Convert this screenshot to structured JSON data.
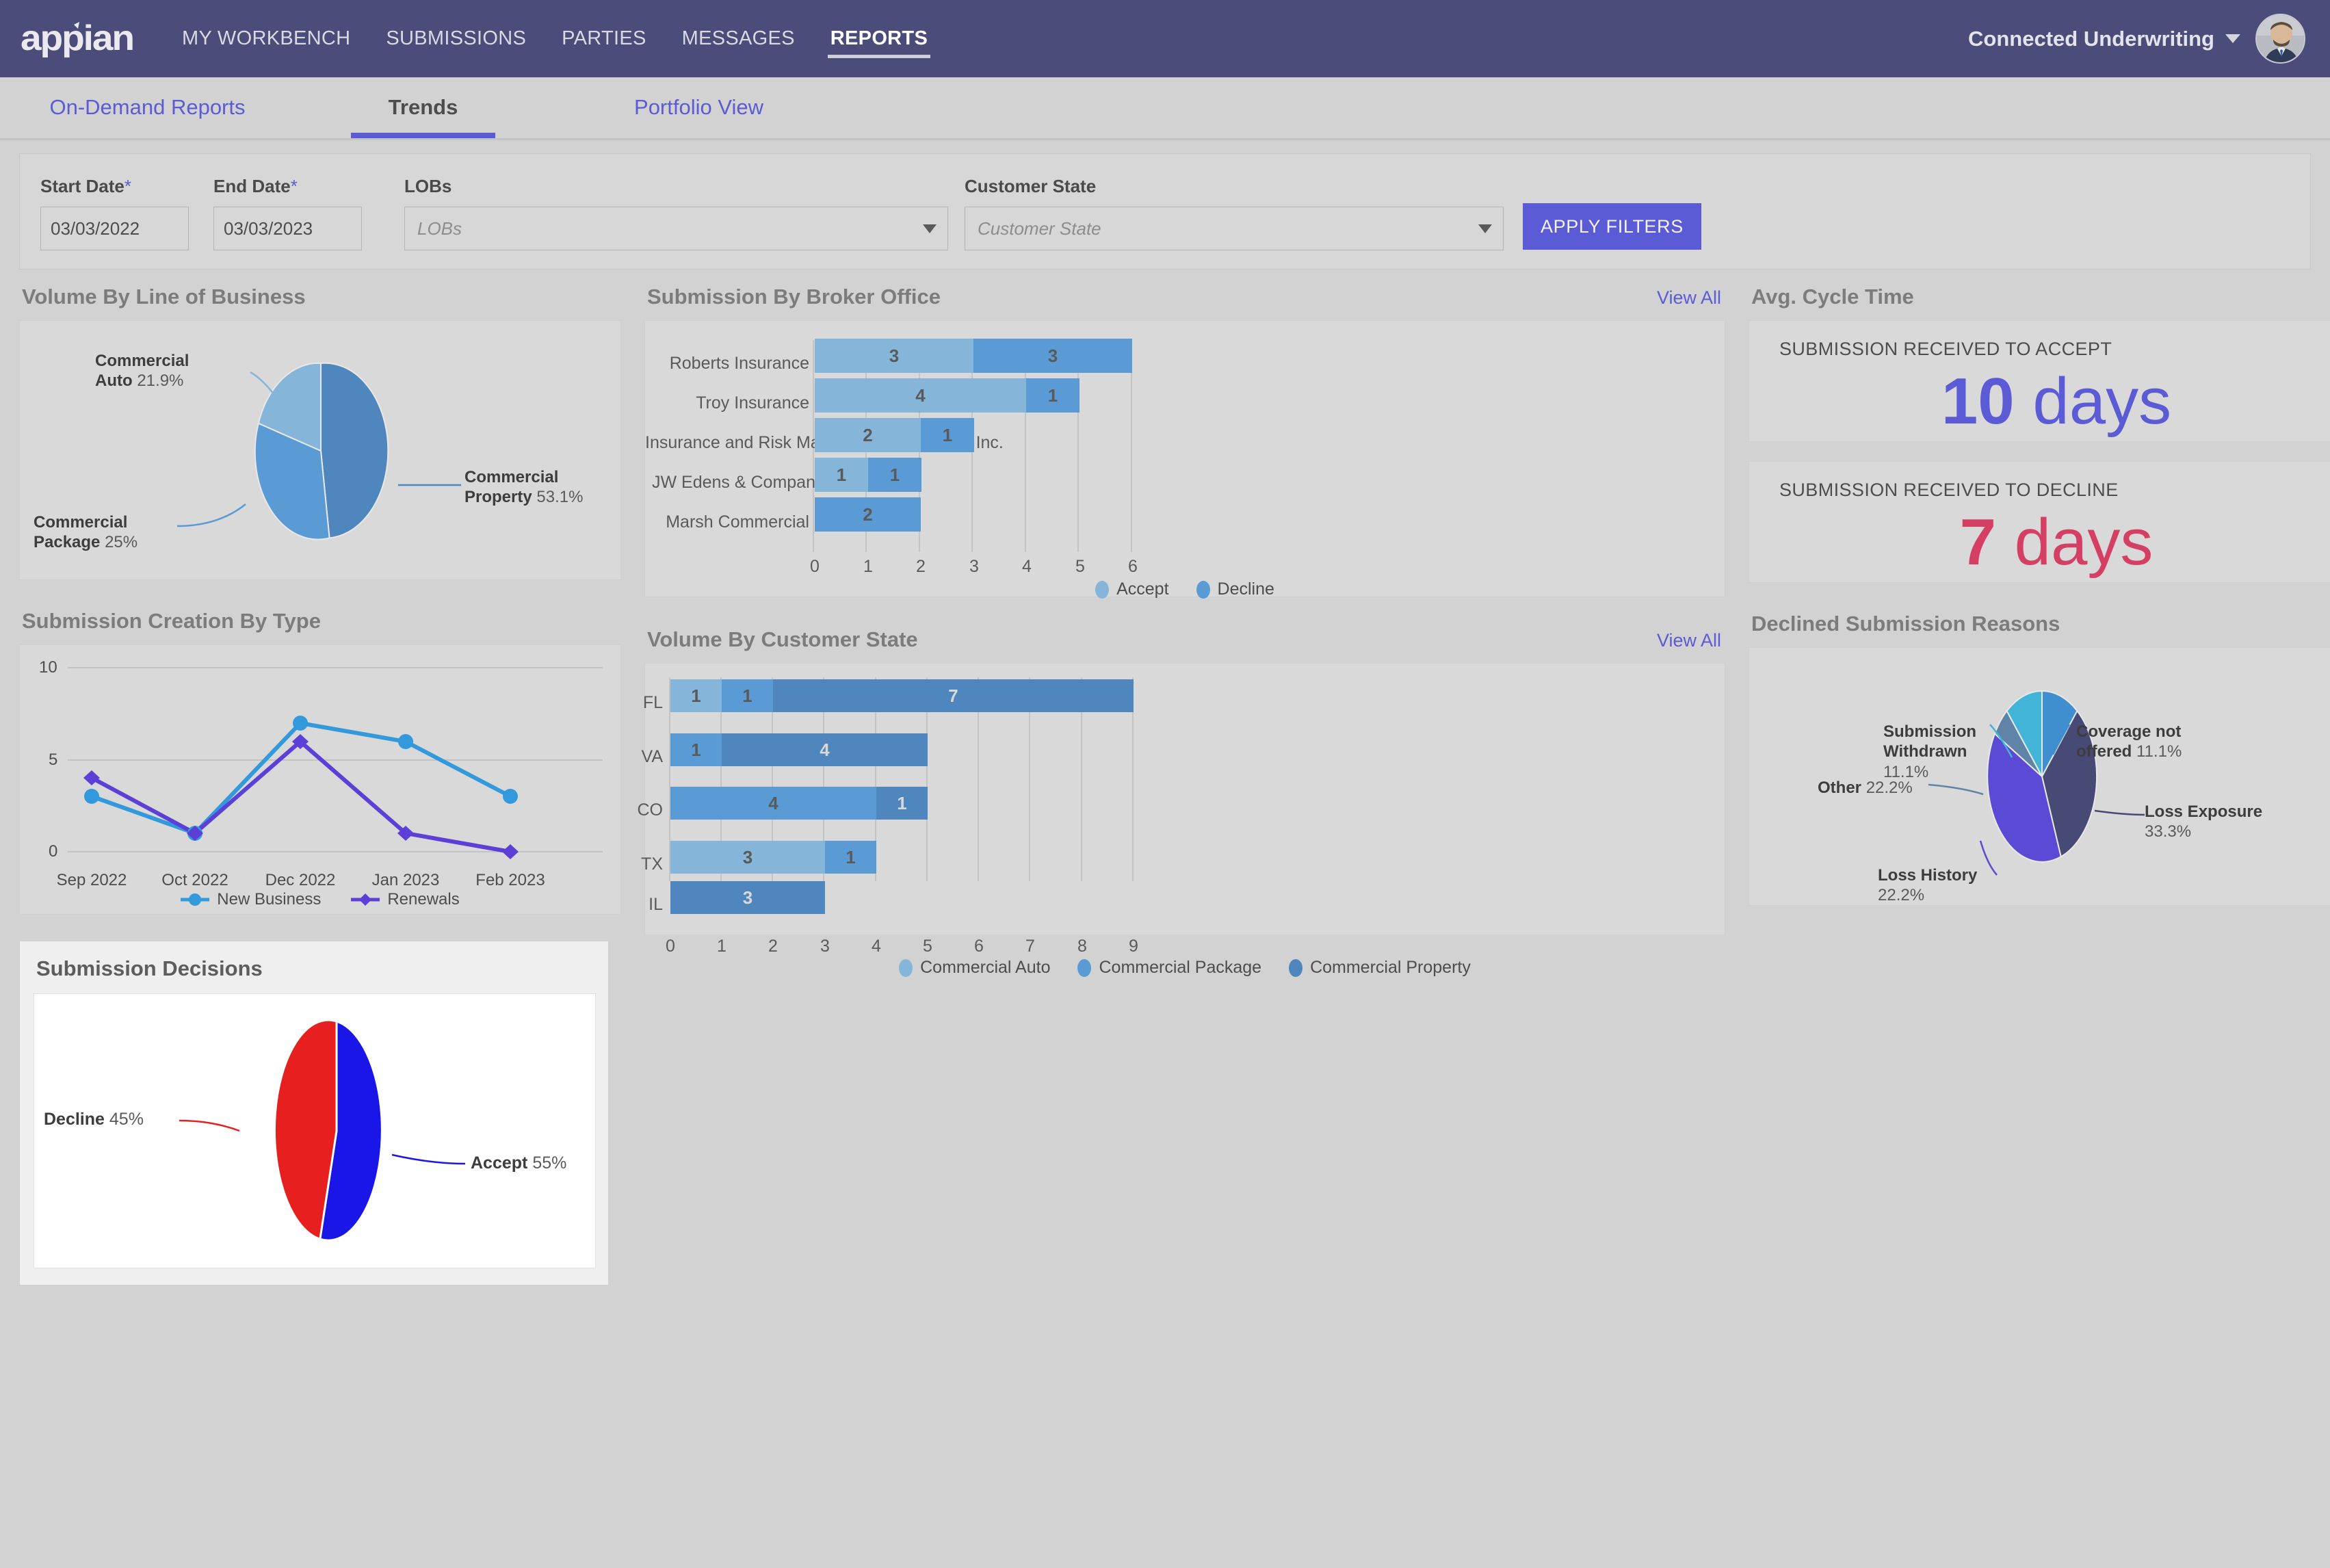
{
  "topnav": {
    "logo_text": "appian",
    "links": [
      {
        "label": "MY WORKBENCH",
        "active": false
      },
      {
        "label": "SUBMISSIONS",
        "active": false
      },
      {
        "label": "PARTIES",
        "active": false
      },
      {
        "label": "MESSAGES",
        "active": false
      },
      {
        "label": "REPORTS",
        "active": true
      }
    ],
    "org": "Connected Underwriting"
  },
  "tabs": [
    {
      "label": "On-Demand Reports",
      "active": false
    },
    {
      "label": "Trends",
      "active": true
    },
    {
      "label": "Portfolio View",
      "active": false
    }
  ],
  "filters": {
    "start_date": {
      "label": "Start Date",
      "required": "*",
      "value": "03/03/2022"
    },
    "end_date": {
      "label": "End Date",
      "required": "*",
      "value": "03/03/2023"
    },
    "lobs": {
      "label": "LOBs",
      "placeholder": "LOBs",
      "value": ""
    },
    "customer_state": {
      "label": "Customer State",
      "placeholder": "Customer State",
      "value": ""
    },
    "apply_label": "APPLY FILTERS"
  },
  "sections": {
    "volume_lob": "Volume By Line of Business",
    "submission_creation": "Submission Creation By Type",
    "submission_decisions": "Submission Decisions",
    "broker_office": "Submission By Broker Office",
    "customer_state": "Volume By Customer State",
    "cycle_time": "Avg. Cycle Time",
    "declined_reasons": "Declined Submission Reasons",
    "view_all": "View All"
  },
  "cycle_time": {
    "accept": {
      "label": "SUBMISSION RECEIVED TO ACCEPT",
      "number": "10",
      "unit": "days",
      "color": "#5b5bd6"
    },
    "decline": {
      "label": "SUBMISSION RECEIVED TO DECLINE",
      "number": "7",
      "unit": "days",
      "color": "#d43f63"
    }
  },
  "colors": {
    "accent": "#5b5bd6",
    "navbar": "#4b4c79",
    "bar_light": "#86b5da",
    "bar_medium": "#5b9bd5",
    "bar_dark": "#4e86bd",
    "decline_red": "#e81f1f",
    "accept_blue": "#1a16e8"
  },
  "chart_data": [
    {
      "type": "pie",
      "id": "volume-by-lob",
      "title": "Volume By Line of Business",
      "labels": [
        "Commercial Property",
        "Commercial Package",
        "Commercial Auto"
      ],
      "values": [
        53.1,
        25,
        21.9
      ],
      "value_labels": [
        "53.1%",
        "25%",
        "21.9%"
      ],
      "colors": [
        "#4e86bd",
        "#5b9bd5",
        "#86b5da"
      ],
      "legend": "callout-labels"
    },
    {
      "type": "line",
      "id": "submission-creation-by-type",
      "title": "Submission Creation By Type",
      "categories": [
        "Sep 2022",
        "Oct 2022",
        "Dec 2022",
        "Jan 2023",
        "Feb 2023"
      ],
      "series": [
        {
          "name": "New Business",
          "values": [
            3,
            1,
            7,
            6,
            3
          ],
          "color": "#3399dd"
        },
        {
          "name": "Renewals",
          "values": [
            4,
            1,
            6,
            1,
            0
          ],
          "color": "#5b3fd6"
        }
      ],
      "ylim": [
        0,
        10
      ],
      "yticks": [
        0,
        5,
        10
      ],
      "xlabel": "",
      "ylabel": "",
      "grid": true,
      "legend": "bottom"
    },
    {
      "type": "pie",
      "id": "submission-decisions",
      "title": "Submission Decisions",
      "labels": [
        "Accept",
        "Decline"
      ],
      "values": [
        55,
        45
      ],
      "value_labels": [
        "55%",
        "45%"
      ],
      "colors": [
        "#1a16e8",
        "#e81f1f"
      ],
      "legend": "callout-labels"
    },
    {
      "type": "bar",
      "id": "submission-by-broker-office",
      "title": "Submission By Broker Office",
      "orientation": "horizontal",
      "stacked": true,
      "categories": [
        "Roberts Insurance",
        "Troy Insurance",
        "Insurance and Risk Management Services, Inc.",
        "JW Edens & Company",
        "Marsh Commercial"
      ],
      "series": [
        {
          "name": "Accept",
          "color": "#86b5da",
          "values": [
            3,
            4,
            2,
            1,
            0
          ]
        },
        {
          "name": "Decline",
          "color": "#5b9bd5",
          "values": [
            3,
            1,
            1,
            1,
            2
          ]
        }
      ],
      "xticks": [
        0,
        1,
        2,
        3,
        4,
        5,
        6
      ],
      "xlim": [
        0,
        6
      ],
      "grid": true,
      "legend": "bottom"
    },
    {
      "type": "bar",
      "id": "volume-by-customer-state",
      "title": "Volume By Customer State",
      "orientation": "horizontal",
      "stacked": true,
      "categories": [
        "FL",
        "VA",
        "CO",
        "TX",
        "IL"
      ],
      "series": [
        {
          "name": "Commercial Auto",
          "color": "#86b5da",
          "values": [
            1,
            0,
            4,
            3,
            0
          ]
        },
        {
          "name": "Commercial Package",
          "color": "#5b9bd5",
          "values": [
            1,
            1,
            1,
            1,
            0
          ]
        },
        {
          "name": "Commercial Property",
          "color": "#4e86bd",
          "values": [
            7,
            4,
            0,
            0,
            3
          ]
        }
      ],
      "xticks": [
        0,
        1,
        2,
        3,
        4,
        5,
        6,
        7,
        8,
        9
      ],
      "xlim": [
        0,
        9
      ],
      "grid": true,
      "legend": "bottom"
    },
    {
      "type": "pie",
      "id": "declined-submission-reasons",
      "title": "Declined Submission Reasons",
      "labels": [
        "Loss Exposure",
        "Loss History",
        "Other",
        "Submission Withdrawn",
        "Coverage not offered"
      ],
      "values": [
        33.3,
        22.2,
        22.2,
        11.1,
        11.1
      ],
      "value_labels": [
        "33.3%",
        "22.2%",
        "22.2%",
        "11.1%",
        "11.1%"
      ],
      "colors": [
        "#464a75",
        "#5b4ad6",
        "#5f84a8",
        "#41b4d8",
        "#3f8fd0"
      ],
      "legend": "callout-labels"
    }
  ],
  "lob_labels": {
    "auto_name": "Commercial",
    "auto_name2": "Auto",
    "auto_pct": "21.9%",
    "prop_name": "Commercial",
    "prop_name2": "Property",
    "prop_pct": "53.1%",
    "pkg_name": "Commercial",
    "pkg_name2": "Package",
    "pkg_pct": "25%"
  },
  "decision_labels": {
    "decline_name": "Decline",
    "decline_pct": "45%",
    "accept_name": "Accept",
    "accept_pct": "55%"
  },
  "declined_labels": {
    "withdrawn_l1": "Submission",
    "withdrawn_l2": "Withdrawn",
    "withdrawn_pct": "11.1%",
    "coverage_l1": "Coverage not",
    "coverage_l2": "offered",
    "coverage_pct": "11.1%",
    "other_name": "Other",
    "other_pct": "22.2%",
    "exposure_name": "Loss Exposure",
    "exposure_pct": "33.3%",
    "history_name": "Loss History",
    "history_pct": "22.2%"
  }
}
